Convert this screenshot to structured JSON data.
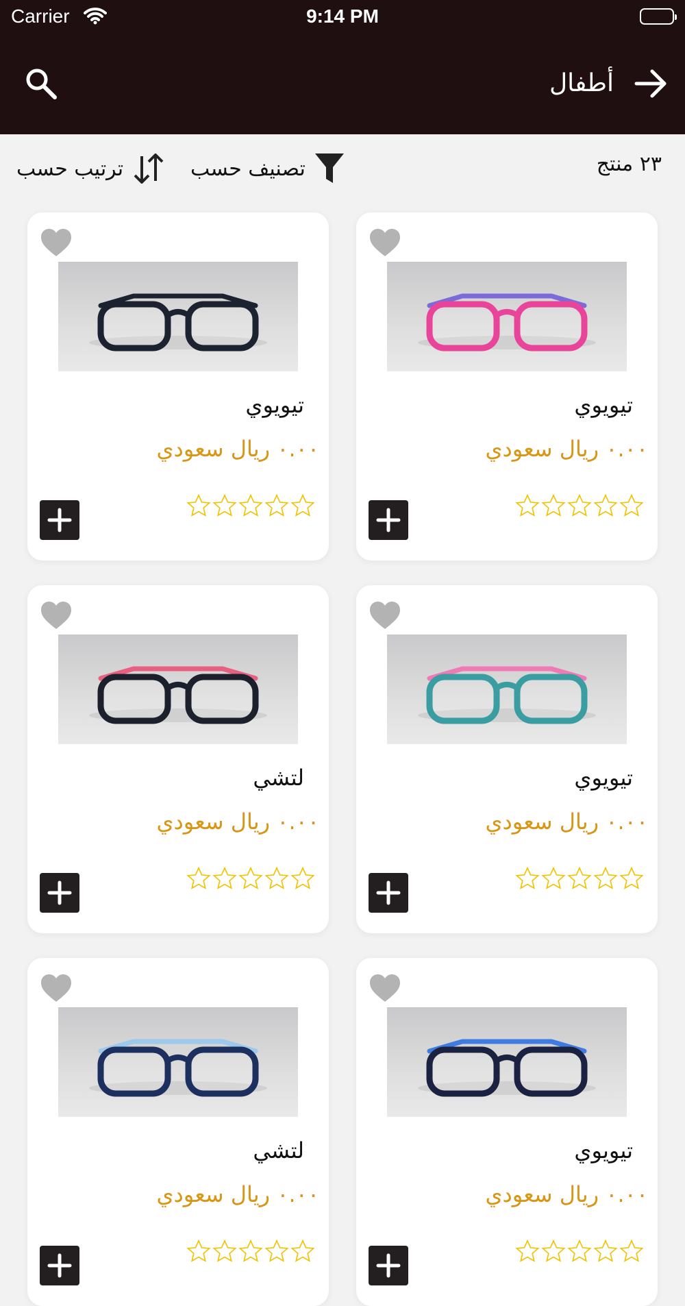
{
  "status_bar": {
    "carrier": "Carrier",
    "time": "9:14 PM"
  },
  "header": {
    "title": "أطفال"
  },
  "toolbar": {
    "count_label": "٢٣ منتج",
    "filter_label": "تصنيف حسب",
    "sort_label": "ترتيب حسب"
  },
  "colors": {
    "header_bg": "#200f10",
    "price": "#d89614",
    "star": "#f2c200",
    "favorite_inactive": "#b3b3b3",
    "add_button": "#231f20"
  },
  "rating_max": 5,
  "products": [
    {
      "name": "تيويوي",
      "price": "٠.٠٠ ريال سعودي",
      "rating": 0,
      "frame_color": "#e8459a",
      "temple_color": "#7a6bd8"
    },
    {
      "name": "تيويوي",
      "price": "٠.٠٠ ريال سعودي",
      "rating": 0,
      "frame_color": "#1d2230",
      "temple_color": "#1d2230"
    },
    {
      "name": "تيويوي",
      "price": "٠.٠٠ ريال سعودي",
      "rating": 0,
      "frame_color": "#3a9da1",
      "temple_color": "#f07ab4"
    },
    {
      "name": "لتشي",
      "price": "٠.٠٠ ريال سعودي",
      "rating": 0,
      "frame_color": "#1c1f2c",
      "temple_color": "#e8607f"
    },
    {
      "name": "تيويوي",
      "price": "٠.٠٠ ريال سعودي",
      "rating": 0,
      "frame_color": "#1b2140",
      "temple_color": "#3f7be0"
    },
    {
      "name": "لتشي",
      "price": "٠.٠٠ ريال سعودي",
      "rating": 0,
      "frame_color": "#1c2f5e",
      "temple_color": "#9cc9ec"
    }
  ]
}
